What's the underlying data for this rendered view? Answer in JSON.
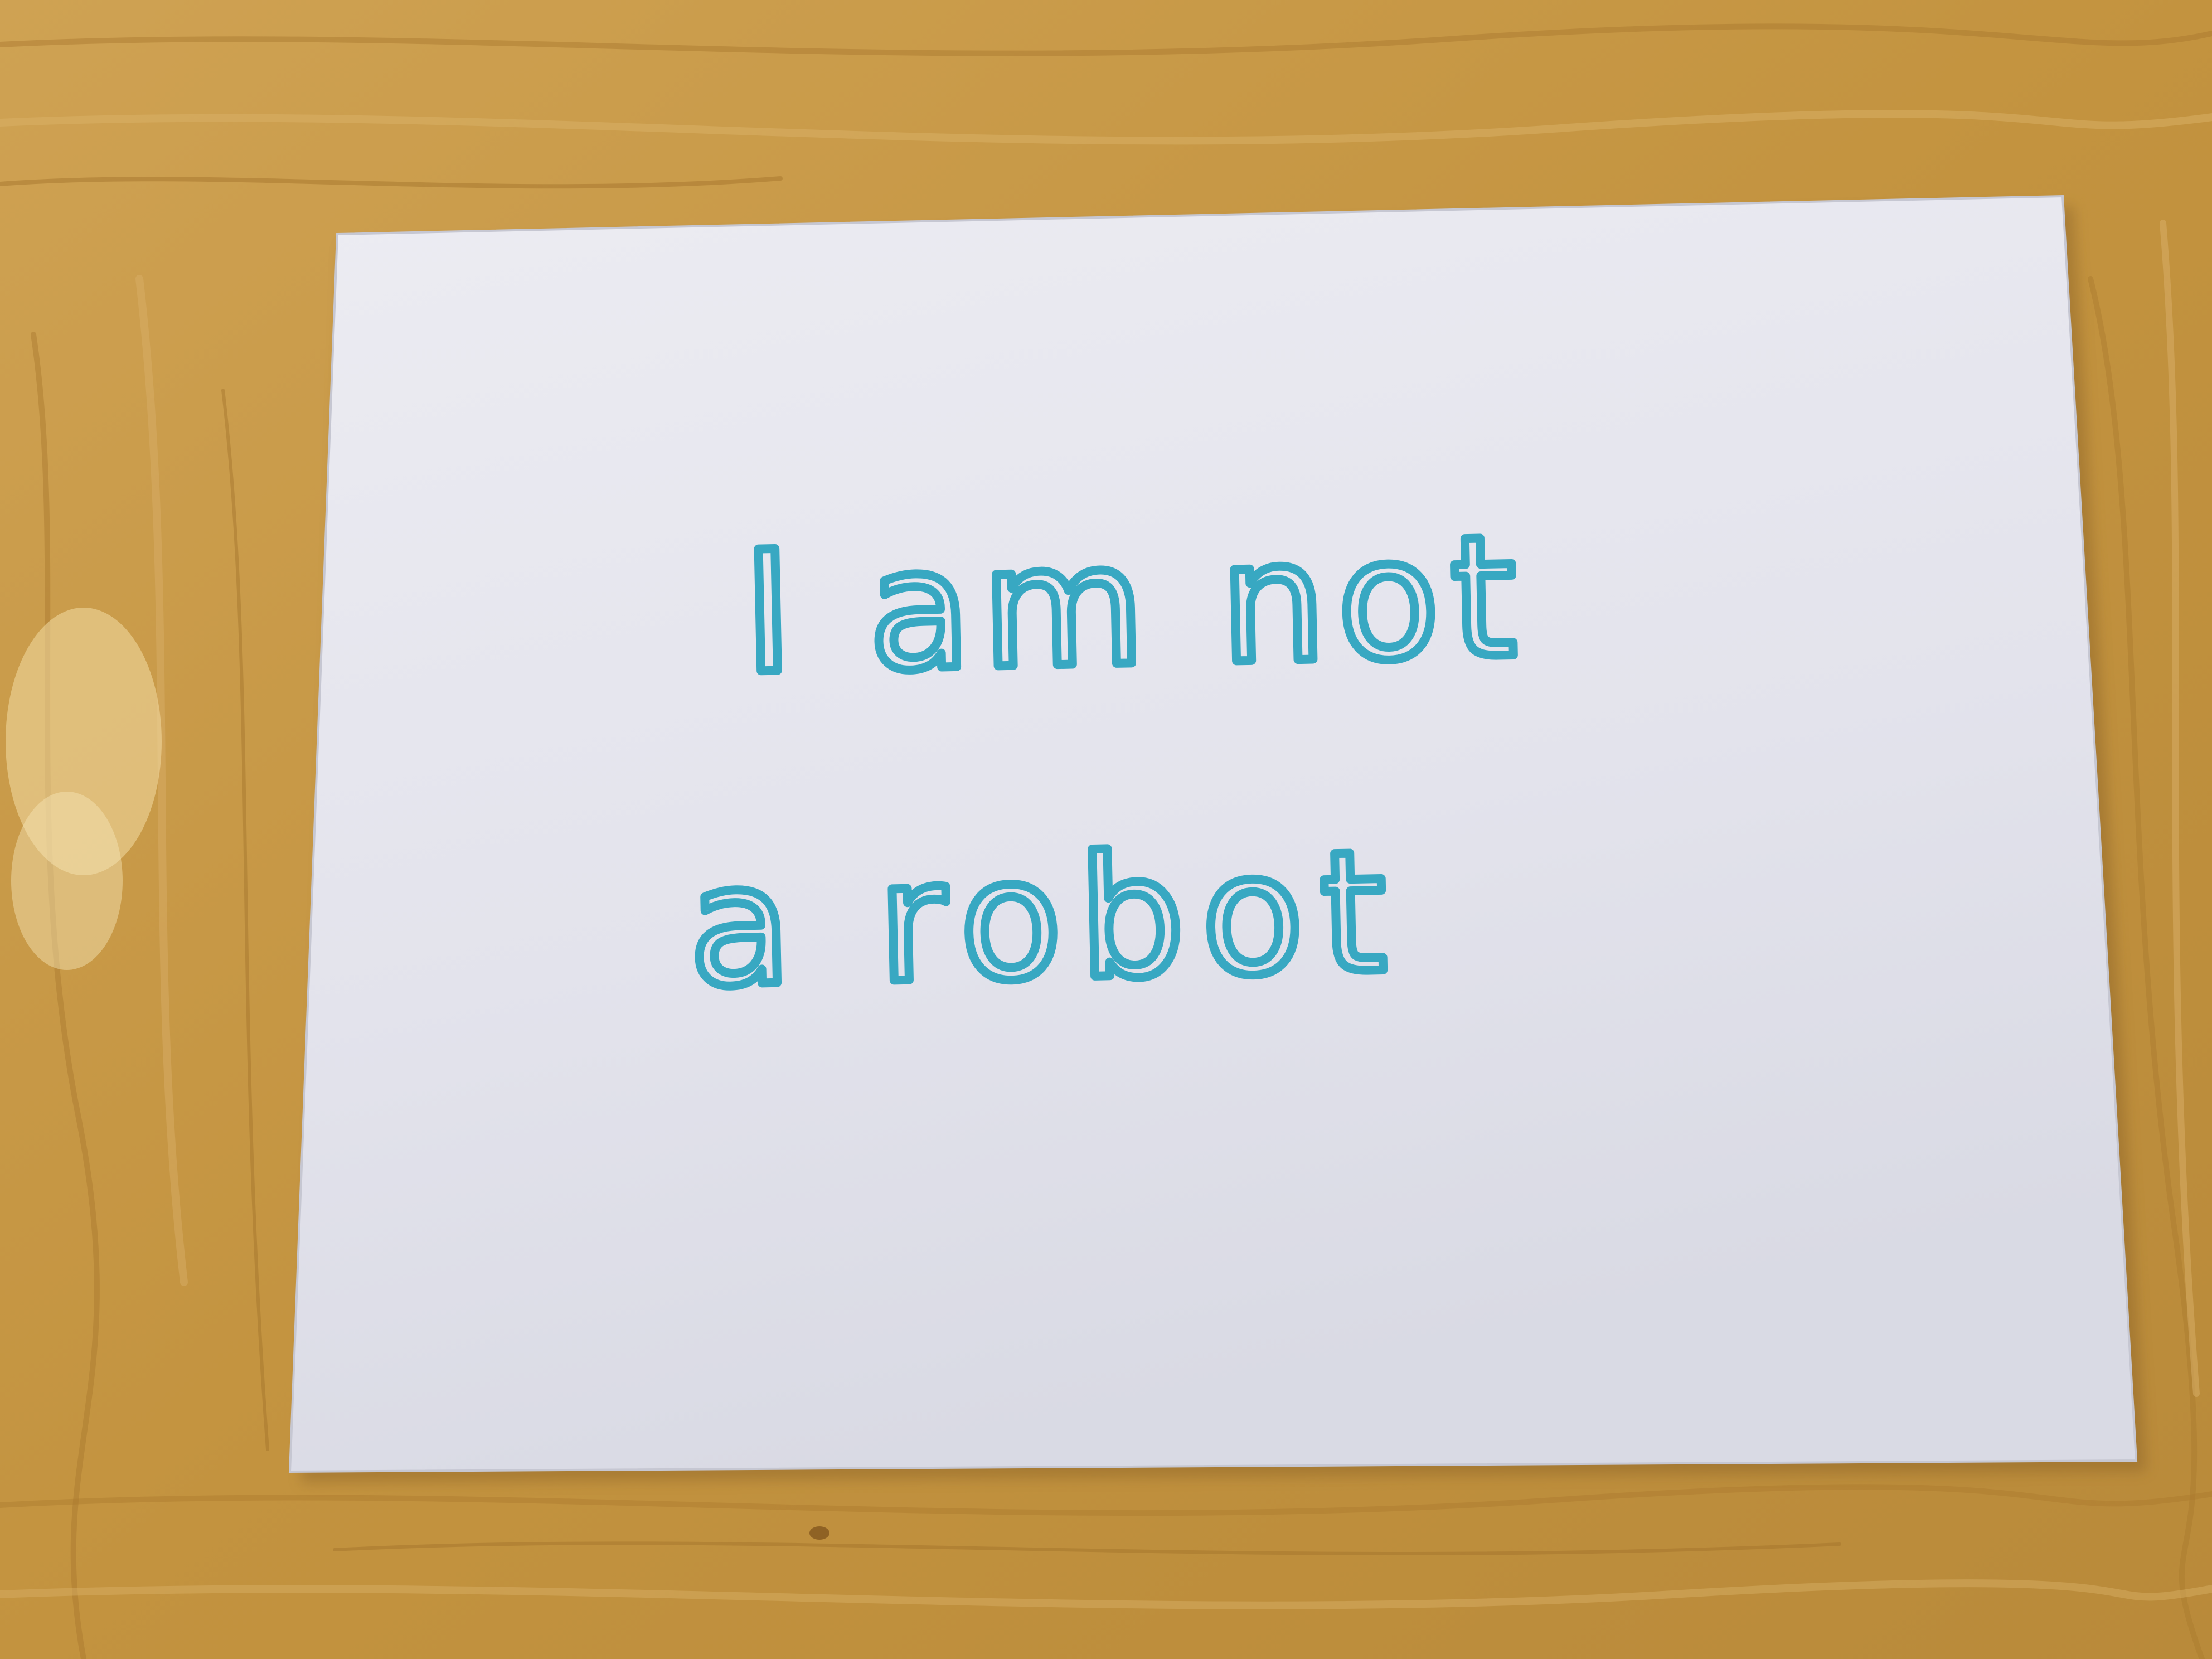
{
  "photo": {
    "note": {
      "lines": [
        "I am not",
        "a robot"
      ]
    },
    "colors": {
      "table": "#c89a4a",
      "table_dark": "#a8782f",
      "table_light": "#dcb467",
      "paper": "#e6e6ee",
      "paper_shadow": "#cfd0da",
      "ink": "#38a8c2",
      "ink_dark": "#1f8aa6"
    }
  }
}
